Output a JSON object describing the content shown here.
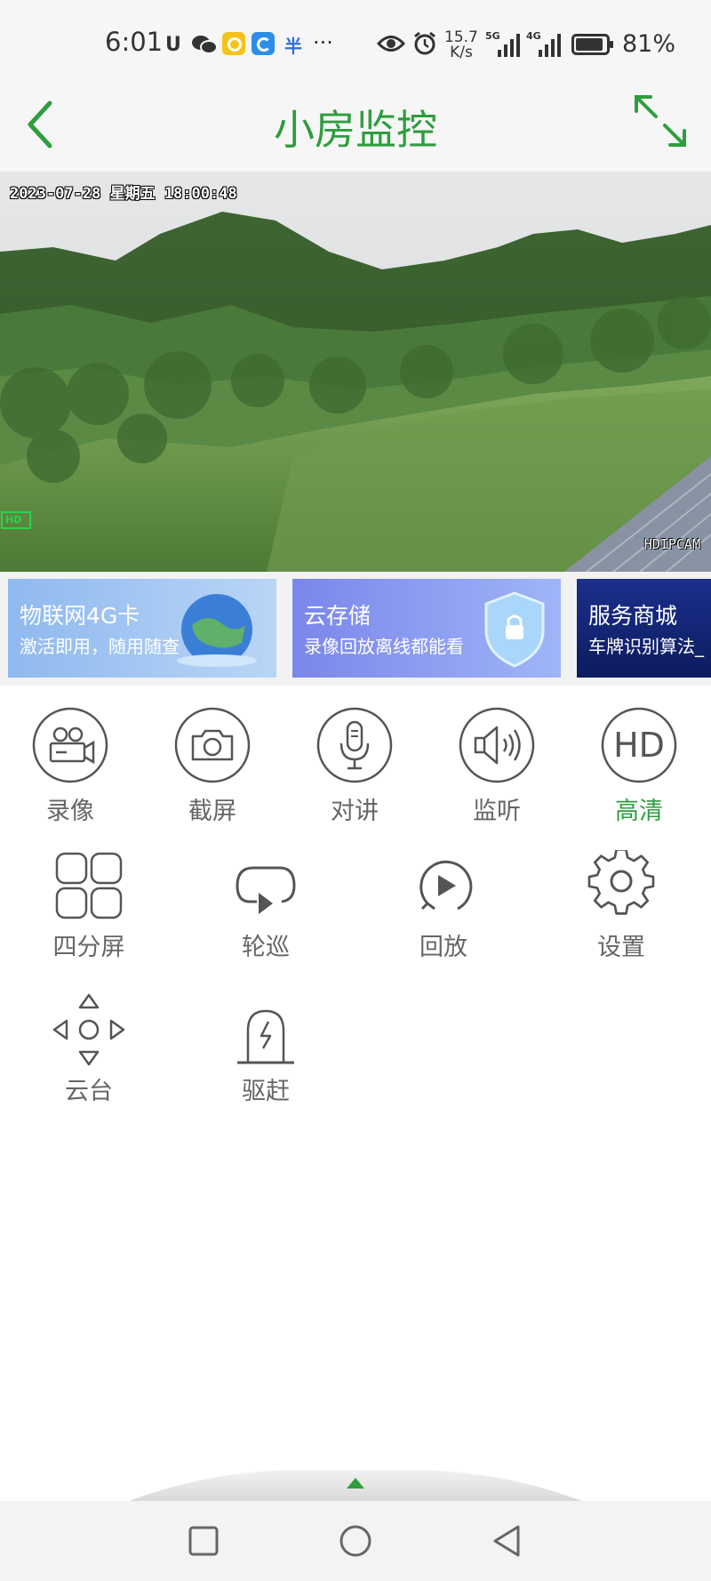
{
  "status_bar": {
    "time": "6:01",
    "network_speed_value": "15.7",
    "network_speed_unit": "K/s",
    "signal_1": "5G",
    "signal_2": "4G",
    "battery": "81%",
    "more": "···"
  },
  "header": {
    "title": "小房监控",
    "back_icon": "chevron-left-icon",
    "expand_icon": "fullscreen-icon"
  },
  "video": {
    "timestamp": "2023-07-28 星期五 18:00:48",
    "watermark": "HDIPCAM",
    "hd_tag": "HD"
  },
  "banners": [
    {
      "title": "物联网4G卡",
      "subtitle": "激活即用，随用随查",
      "color": "#8fb9ef"
    },
    {
      "title": "云存储",
      "subtitle": "录像回放离线都能看",
      "color": "#7d8df0"
    },
    {
      "title": "服务商城",
      "subtitle": "车牌识别算法_",
      "color": "#1a2f8a"
    }
  ],
  "controls_row1": [
    {
      "label": "录像",
      "icon": "video-camera-icon"
    },
    {
      "label": "截屏",
      "icon": "camera-icon"
    },
    {
      "label": "对讲",
      "icon": "microphone-icon"
    },
    {
      "label": "监听",
      "icon": "speaker-icon"
    },
    {
      "label": "高清",
      "icon": "hd-icon",
      "active": true
    }
  ],
  "controls_row2": [
    {
      "label": "四分屏",
      "icon": "quad-screen-icon"
    },
    {
      "label": "轮巡",
      "icon": "patrol-icon"
    },
    {
      "label": "回放",
      "icon": "playback-icon"
    },
    {
      "label": "设置",
      "icon": "gear-icon"
    }
  ],
  "controls_row3": [
    {
      "label": "云台",
      "icon": "ptz-icon"
    },
    {
      "label": "驱赶",
      "icon": "alarm-light-icon"
    }
  ],
  "colors": {
    "accent": "#2e9d3e",
    "label": "#666666",
    "icon_stroke": "#555555"
  }
}
